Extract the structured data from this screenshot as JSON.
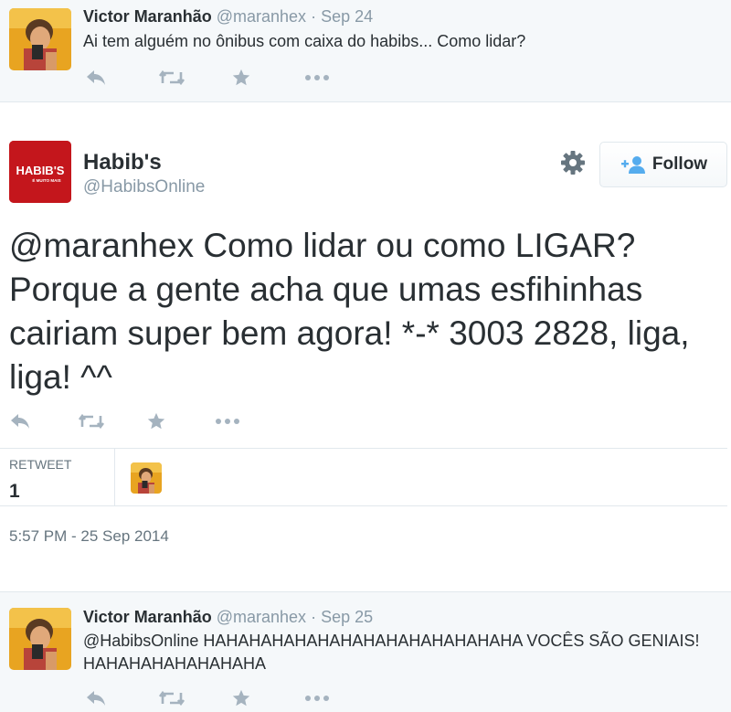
{
  "reply_top": {
    "name": "Victor Maranhão",
    "handle": "@maranhex",
    "sep": "·",
    "date": "Sep 24",
    "text": "Ai tem alguém no ônibus com caixa do habibs... Como lidar?"
  },
  "main_tweet": {
    "name": "Habib's",
    "handle": "@HabibsOnline",
    "logo_text": "HABIB'S",
    "logo_subtext": "É MUITO MAIS",
    "follow_label": "Follow",
    "text": "@maranhex Como lidar ou como LIGAR? Porque a gente acha que umas esfihinhas cairiam super bem agora! *-* 3003 2828, liga, liga! ^^",
    "stats_label": "RETWEET",
    "stats_value": "1",
    "timestamp": "5:57 PM - 25 Sep 2014"
  },
  "reply_bottom": {
    "name": "Victor Maranhão",
    "handle": "@maranhex",
    "sep": "·",
    "date": "Sep 25",
    "text": "@HabibsOnline HAHAHAHAHAHAHAHAHAHAHAHAHAHA VOCÊS SÃO GENIAIS! HAHAHAHAHAHAHAHA"
  },
  "icons": [
    "reply-icon",
    "retweet-icon",
    "favorite-icon",
    "more-icon",
    "gear-icon",
    "follow-user-icon"
  ],
  "colors": {
    "brand_red": "#c4161c",
    "muted_text": "#8899a6",
    "icon_gray": "#a5b3bf",
    "follow_blue": "#55acee",
    "reply_bg": "#f5f8fa"
  }
}
